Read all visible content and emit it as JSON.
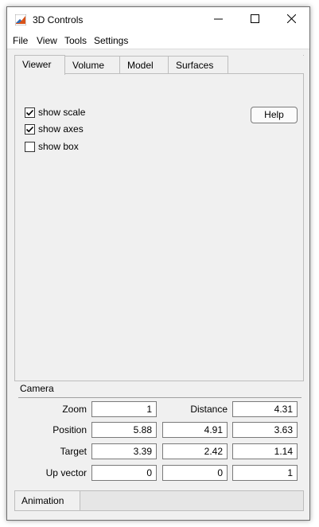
{
  "window": {
    "title": "3D Controls"
  },
  "menu": [
    "File",
    "View",
    "Tools",
    "Settings"
  ],
  "tabs": [
    "Viewer",
    "Volume",
    "Model",
    "Surfaces"
  ],
  "options": [
    {
      "label": "show scale",
      "checked": true
    },
    {
      "label": "show axes",
      "checked": true
    },
    {
      "label": "show box",
      "checked": false
    }
  ],
  "help_label": "Help",
  "camera": {
    "title": "Camera",
    "zoom_label": "Zoom",
    "zoom": "1",
    "distance_label": "Distance",
    "distance": "4.31",
    "position_label": "Position",
    "position": [
      "5.88",
      "4.91",
      "3.63"
    ],
    "target_label": "Target",
    "target": [
      "3.39",
      "2.42",
      "1.14"
    ],
    "upvector_label": "Up vector",
    "upvector": [
      "0",
      "0",
      "1"
    ]
  },
  "animation_label": "Animation",
  "colors": {
    "accent": "#d95319",
    "frame": "#f0f0f0"
  }
}
